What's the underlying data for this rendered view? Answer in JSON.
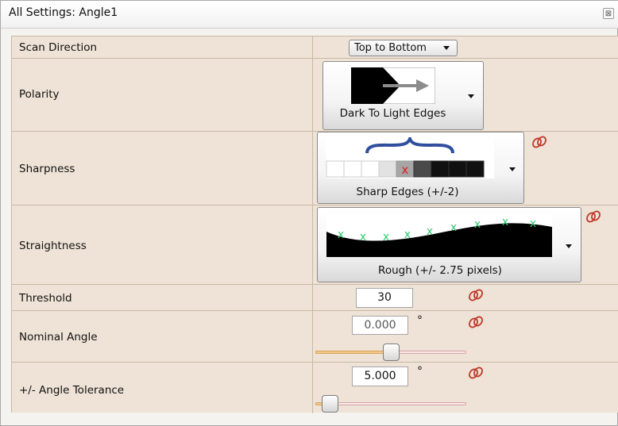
{
  "window": {
    "title": "All Settings: Angle1",
    "close_glyph": "⊠"
  },
  "rows": {
    "scan_direction": {
      "label": "Scan Direction",
      "value": "Top to Bottom"
    },
    "polarity": {
      "label": "Polarity",
      "caption": "Dark To Light Edges"
    },
    "sharpness": {
      "label": "Sharpness",
      "caption": "Sharp Edges (+/-2)"
    },
    "straightness": {
      "label": "Straightness",
      "caption": "Rough (+/- 2.75 pixels)"
    },
    "threshold": {
      "label": "Threshold",
      "value": "30"
    },
    "nominal_angle": {
      "label": "Nominal Angle",
      "value": "0.000",
      "unit": "°",
      "slider_fraction": 0.5
    },
    "angle_tolerance": {
      "label": "+/- Angle Tolerance",
      "value": "5.000",
      "unit": "°",
      "slider_fraction": 0.05
    }
  },
  "icons": {
    "link": "link-icon",
    "dropdown": "chevron-down-icon"
  },
  "colors": {
    "grid_bg": "#eee3d6",
    "grid_line": "#c8b8a6",
    "link_icon": "#c0392b",
    "marker_green": "#2ecc71",
    "marker_red": "#e01b1b",
    "brace_blue": "#2f4f9e"
  }
}
